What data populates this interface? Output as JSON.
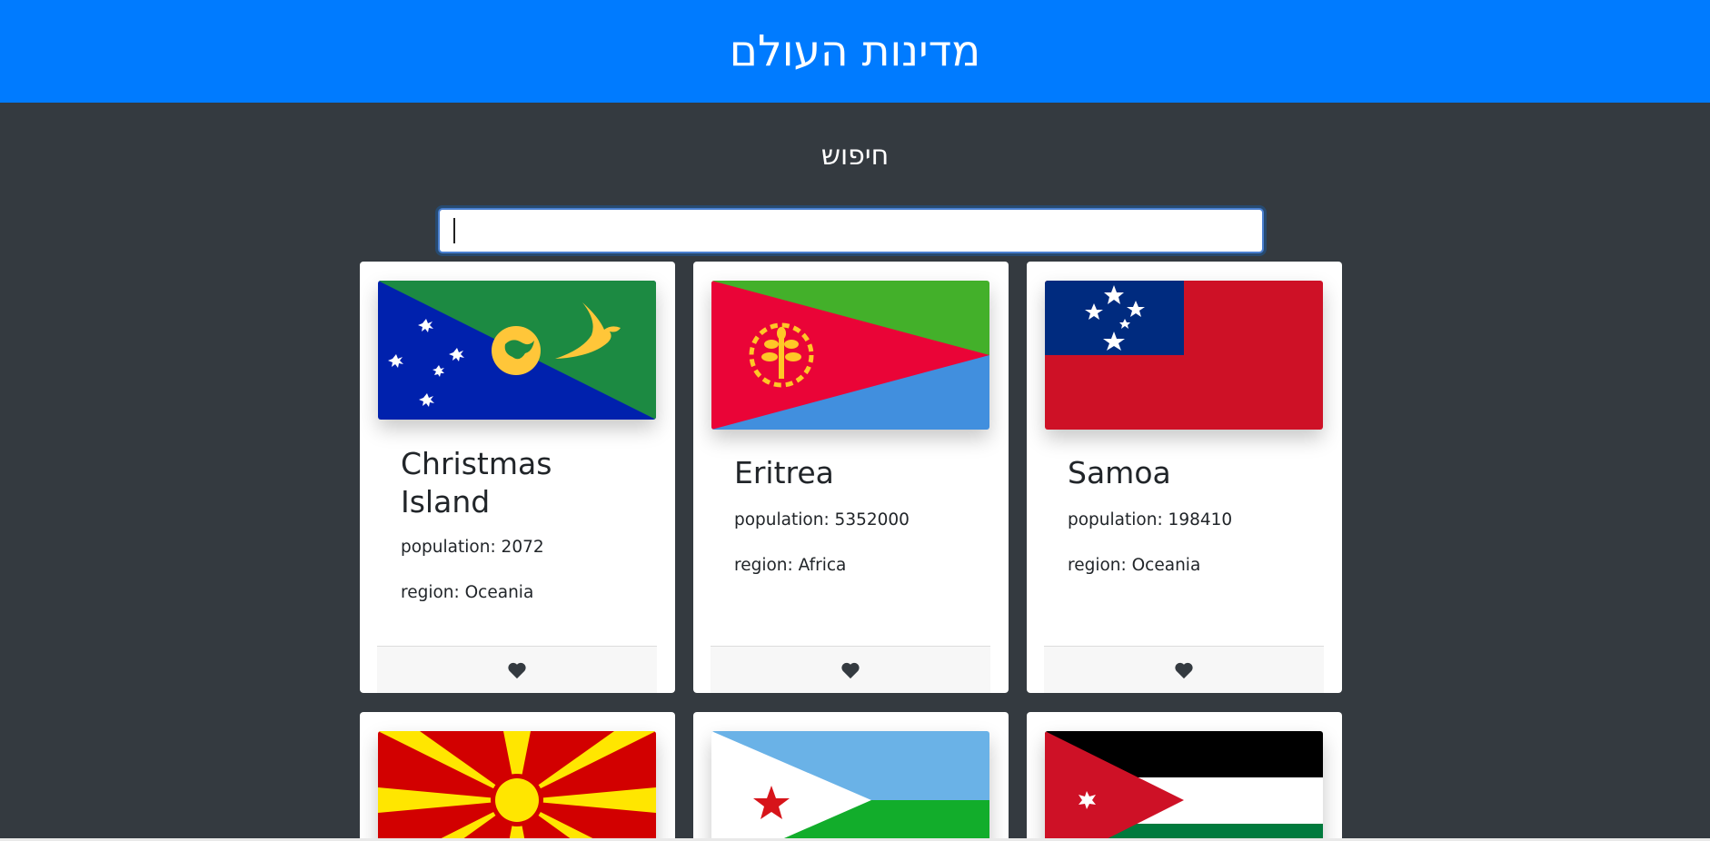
{
  "header": {
    "title": "מדינות העולם"
  },
  "search": {
    "title": "חיפוש",
    "value": "",
    "placeholder": ""
  },
  "countries": [
    {
      "name": "Christmas Island",
      "population_label": "population: 2072",
      "region_label": "region: Oceania",
      "flag": "christmas-island-flag"
    },
    {
      "name": "Eritrea",
      "population_label": "population: 5352000",
      "region_label": "region: Africa",
      "flag": "eritrea-flag"
    },
    {
      "name": "Samoa",
      "population_label": "population: 198410",
      "region_label": "region: Oceania",
      "flag": "samoa-flag"
    },
    {
      "flag": "north-macedonia-flag"
    },
    {
      "flag": "djibouti-flag"
    },
    {
      "flag": "jordan-flag"
    }
  ],
  "icons": {
    "favorite": "heart-icon"
  },
  "colors": {
    "header": "#007bff",
    "background": "#343a40",
    "card": "#ffffff",
    "heart": "#343a40"
  }
}
